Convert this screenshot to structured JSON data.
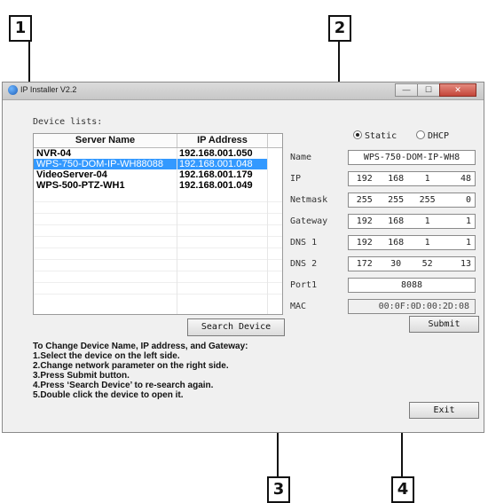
{
  "callouts": [
    "1",
    "2",
    "3",
    "4"
  ],
  "window": {
    "title": "IP Installer V2.2",
    "min_label": "—",
    "max_label": "☐",
    "close_label": "✕"
  },
  "device_list": {
    "caption": "Device lists:",
    "headers": [
      "Server Name",
      "IP Address"
    ],
    "rows": [
      {
        "name": "NVR-04",
        "ip": "192.168.001.050"
      },
      {
        "name": "WPS-750-DOM-IP-WH88088",
        "ip": "192.168.001.048"
      },
      {
        "name": "VideoServer-04",
        "ip": "192.168.001.179"
      },
      {
        "name": "WPS-500-PTZ-WH1",
        "ip": "192.168.001.049"
      }
    ],
    "selected_index": 1
  },
  "search_button": "Search Device",
  "instructions": [
    "To Change Device Name, IP address, and Gateway:",
    "1.Select the device on the left side.",
    "2.Change network parameter on the right side.",
    "3.Press Submit button.",
    "4.Press ‘Search Device’ to re-search again.",
    "5.Double click the device to open it."
  ],
  "mode": {
    "static_label": "Static",
    "dhcp_label": "DHCP",
    "selected": "Static"
  },
  "fields": {
    "name": {
      "label": "Name",
      "value": "WPS-750-DOM-IP-WH8"
    },
    "ip": {
      "label": "IP",
      "octets": [
        "192",
        "168",
        "1",
        "48"
      ]
    },
    "netmask": {
      "label": "Netmask",
      "octets": [
        "255",
        "255",
        "255",
        "0"
      ]
    },
    "gateway": {
      "label": "Gateway",
      "octets": [
        "192",
        "168",
        "1",
        "1"
      ]
    },
    "dns1": {
      "label": "DNS 1",
      "octets": [
        "192",
        "168",
        "1",
        "1"
      ]
    },
    "dns2": {
      "label": "DNS 2",
      "octets": [
        "172",
        "30",
        "52",
        "13"
      ]
    },
    "port": {
      "label": "Port1",
      "value": "8088"
    },
    "mac": {
      "label": "MAC",
      "value": "00:0F:0D:00:2D:08"
    }
  },
  "submit_button": "Submit",
  "exit_button": "Exit",
  "colors": {
    "selection": "#3399ff",
    "window_bg": "#f0f0f0"
  }
}
